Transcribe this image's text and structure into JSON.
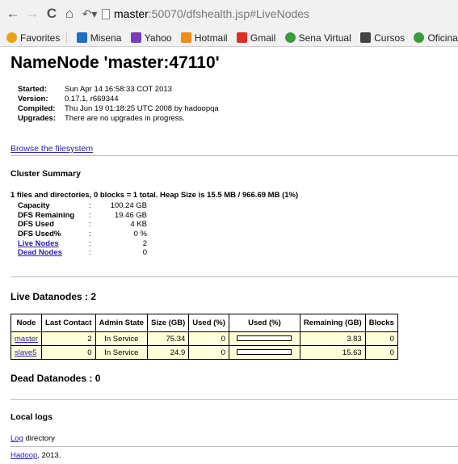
{
  "browser": {
    "address_host": "master",
    "address_rest": ":50070/dfshealth.jsp#LiveNodes",
    "nav": {
      "back": "←",
      "forward": "→",
      "reload": "C",
      "home": "⌂",
      "history": "↶▾"
    },
    "bookmarks": [
      {
        "label": "Favorites",
        "color": "#e8a317"
      },
      {
        "label": "Misena",
        "color": "#1f6fbf"
      },
      {
        "label": "Yahoo",
        "color": "#7b3fb5"
      },
      {
        "label": "Hotmail",
        "color": "#f28b1d"
      },
      {
        "label": "Gmail",
        "color": "#d93025"
      },
      {
        "label": "Sena Virtual",
        "color": "#3a9d3a"
      },
      {
        "label": "Cursos",
        "color": "#444444"
      },
      {
        "label": "Oficina",
        "color": "#3a9d3a"
      }
    ]
  },
  "page": {
    "title": "NameNode 'master:47110'",
    "info": [
      {
        "key": "Started:",
        "value": "Sun Apr 14 16:58:33 COT 2013"
      },
      {
        "key": "Version:",
        "value": "0.17.1, r669344"
      },
      {
        "key": "Compiled:",
        "value": "Thu Jun 19 01:18:25 UTC 2008 by hadoopqa"
      },
      {
        "key": "Upgrades:",
        "value": "There are no upgrades in progress."
      }
    ],
    "browse_link": "Browse the filesystem",
    "cluster_summary_heading": "Cluster Summary",
    "summary_line": "1 files and directories, 0 blocks = 1 total. Heap Size is 15.5 MB / 966.69 MB (1%)",
    "stats": [
      {
        "key": "Capacity",
        "value": "100.24 GB",
        "link": false
      },
      {
        "key": "DFS Remaining",
        "value": "19.46 GB",
        "link": false
      },
      {
        "key": "DFS Used",
        "value": "4 KB",
        "link": false
      },
      {
        "key": "DFS Used%",
        "value": "0 %",
        "link": false
      },
      {
        "key": "Live Nodes",
        "value": "2",
        "link": true
      },
      {
        "key": "Dead Nodes",
        "value": "0",
        "link": true
      }
    ],
    "stat_colon": ":",
    "live_heading": "Live Datanodes : 2",
    "table": {
      "headers": [
        "Node",
        "Last Contact",
        "Admin State",
        "Size (GB)",
        "Used (%)",
        "Used (%)",
        "Remaining (GB)",
        "Blocks"
      ],
      "rows": [
        {
          "node": "master",
          "last_contact": "2",
          "admin_state": "In Service",
          "size": "75.34",
          "used_pct": "0",
          "used_bar": 0.0,
          "remaining": "3.83",
          "blocks": "0"
        },
        {
          "node": "slave5",
          "last_contact": "0",
          "admin_state": "In Service",
          "size": "24.9",
          "used_pct": "0",
          "used_bar": 0.0,
          "remaining": "15.63",
          "blocks": "0"
        }
      ]
    },
    "dead_heading": "Dead Datanodes : 0",
    "local_logs_heading": "Local logs",
    "log_link": "Log",
    "log_text": " directory",
    "footer_link": "Hadoop",
    "footer_text": ", 2013."
  }
}
